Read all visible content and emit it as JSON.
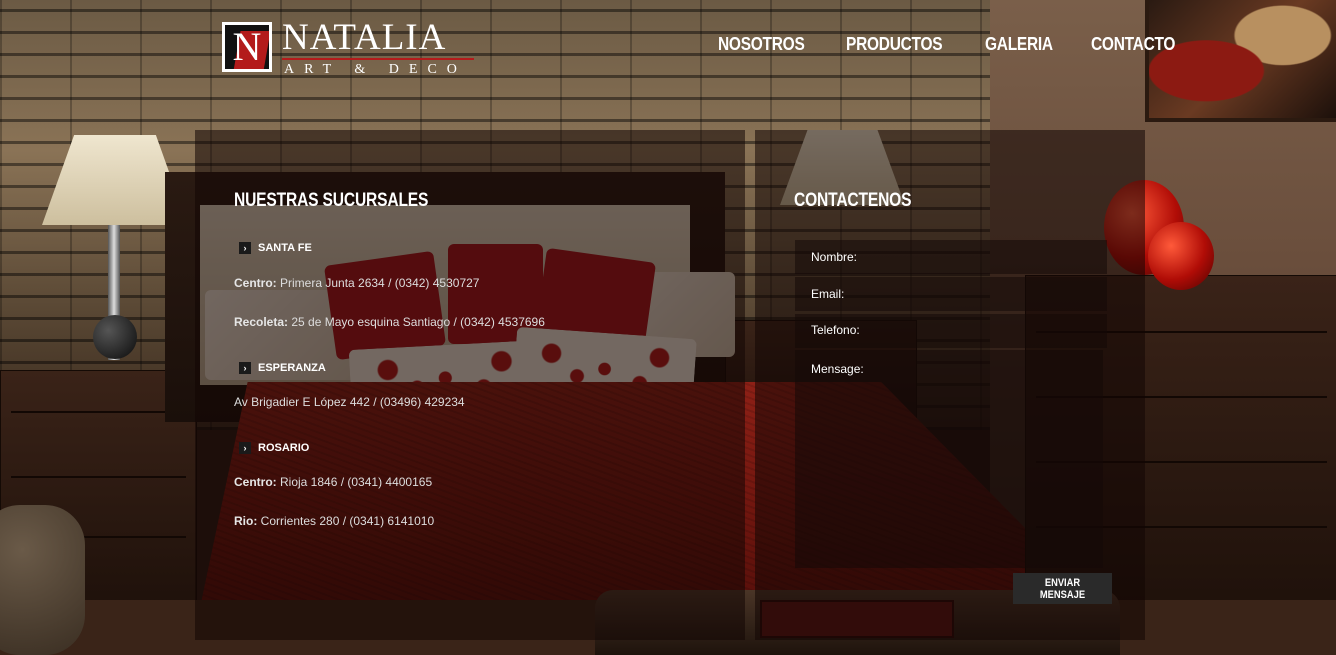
{
  "header": {
    "logo": {
      "name": "NATALIA",
      "tagline": "ART & DECO",
      "mark_letter": "N",
      "accent_color": "#b31b1b"
    },
    "nav": [
      {
        "label": "NOSOTROS"
      },
      {
        "label": "PRODUCTOS"
      },
      {
        "label": "GALERIA"
      },
      {
        "label": "CONTACTO"
      }
    ]
  },
  "branches": {
    "title": "NUESTRAS SUCURSALES",
    "groups": [
      {
        "city": "SANTA FE",
        "entries": [
          {
            "label": "Centro:",
            "text": " Primera Junta 2634 / (0342) 4530727"
          },
          {
            "label": "Recoleta:",
            "text": " 25 de Mayo esquina Santiago / (0342) 4537696"
          }
        ]
      },
      {
        "city": "ESPERANZA",
        "entries": [
          {
            "label": "",
            "text": "Av Brigadier E López 442 / (03496) 429234"
          }
        ]
      },
      {
        "city": "ROSARIO",
        "entries": [
          {
            "label": "Centro:",
            "text": " Rioja 1846 / (0341) 4400165"
          },
          {
            "label": "Rio:",
            "text": " Corrientes 280 / (0341) 6141010"
          }
        ]
      }
    ]
  },
  "contact": {
    "title": "CONTACTENOS",
    "fields": [
      {
        "label": "Nombre:",
        "value": ""
      },
      {
        "label": "Email:",
        "value": ""
      },
      {
        "label": "Telefono:",
        "value": ""
      }
    ],
    "message_label": "Mensage:",
    "message_value": "",
    "submit_label": "ENVIAR MENSAJE"
  }
}
